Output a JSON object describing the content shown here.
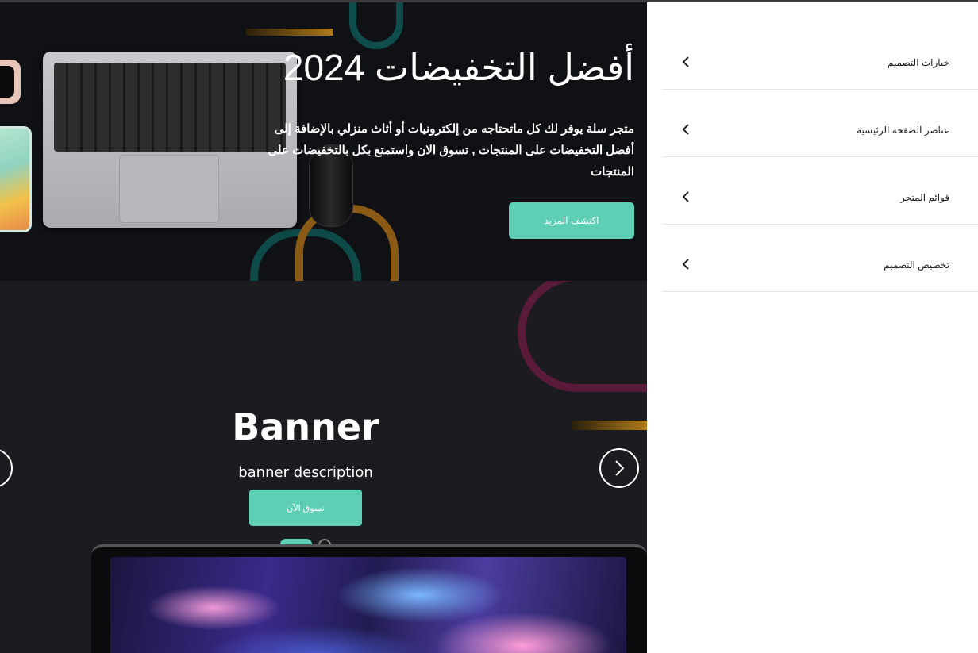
{
  "hero": {
    "title": "أفضل التخفيضات 2024",
    "description": "متجر سلة يوفر لك كل ماتحتاجه من إلكترونيات أو أثاث منزلي بالإضافة إلى أفضل التخفيضات على المنتجات , تسوق الان واستمتع بكل بالتخفيضات على المنتجات",
    "button_label": "اكتشف المزيد"
  },
  "banner": {
    "title": "Banner",
    "description": "banner description",
    "button_label": "تسوق الآن",
    "slides_count": 2,
    "active_slide": 1
  },
  "panel": {
    "items": [
      {
        "label": "خيارات التصميم"
      },
      {
        "label": "عناصر الصفحه الرئيسية"
      },
      {
        "label": "قوائم المتجر"
      },
      {
        "label": "تخصيص التصميم"
      }
    ]
  },
  "colors": {
    "accent": "#5ecfb5",
    "hero_bg": "#0f1115",
    "banner_bg": "#1c1b20"
  },
  "icons": {
    "chevron": "chevron-left-icon",
    "next": "chevron-right-icon",
    "prev": "chevron-left-icon"
  }
}
